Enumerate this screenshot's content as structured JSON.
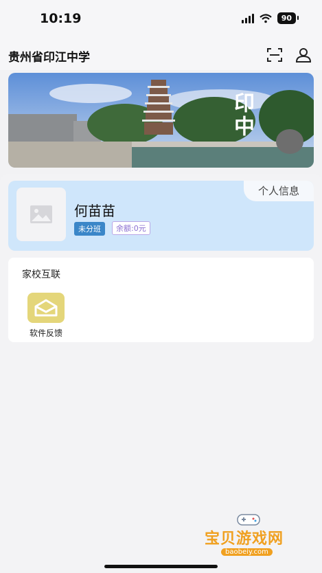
{
  "status": {
    "time": "10:19",
    "battery": "90"
  },
  "header": {
    "title": "贵州省印江中学"
  },
  "banner": {
    "overlay_text": "印中"
  },
  "profile": {
    "name": "何苗苗",
    "class_badge": "未分班",
    "balance_badge": "余额:0元",
    "info_tab": "个人信息"
  },
  "section": {
    "title": "家校互联",
    "items": [
      {
        "label": "软件反馈",
        "icon": "mail-icon"
      }
    ]
  },
  "watermark": {
    "text": "宝贝游戏网",
    "url": "baobeiy.com"
  },
  "colors": {
    "profile_bg": "#cfe6fb",
    "class_badge": "#3a86c8",
    "balance_badge": "#8b6fd0",
    "feature_icon_bg": "#e4d67a"
  }
}
